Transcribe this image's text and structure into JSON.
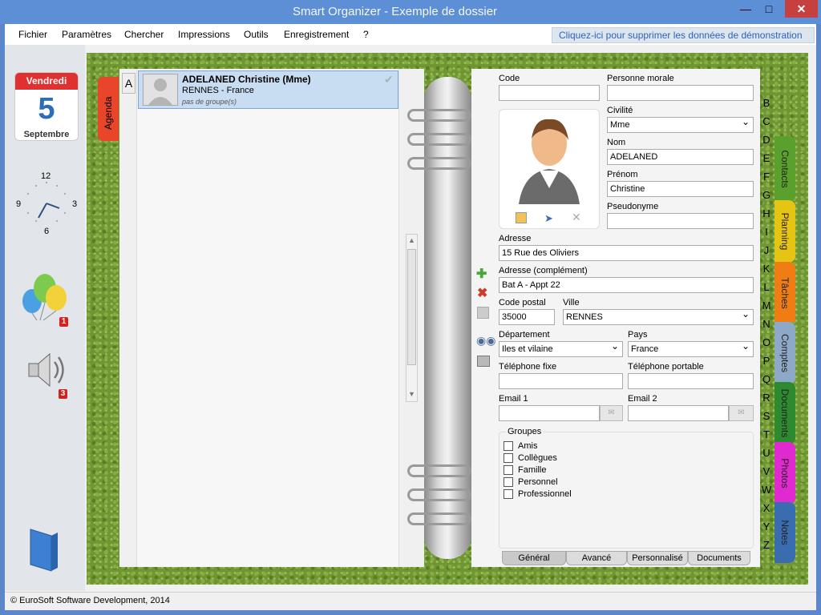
{
  "window": {
    "title": "Smart Organizer - Exemple de dossier",
    "minimize": "—",
    "maximize": "□",
    "close": "✕"
  },
  "menu": {
    "items": [
      "Fichier",
      "Paramètres",
      "Chercher",
      "Impressions",
      "Outils",
      "Enregistrement",
      "?"
    ],
    "demo_link": "Cliquez-ici pour supprimer les données de démonstration"
  },
  "calendar": {
    "weekday": "Vendredi",
    "day": "5",
    "month": "Septembre"
  },
  "clock": {
    "n12": "12",
    "n3": "3",
    "n6": "6",
    "n9": "9"
  },
  "badges": {
    "balloons": "1",
    "sound": "3"
  },
  "left_tab": {
    "label": "Agenda",
    "letter": "A"
  },
  "contact": {
    "name": "ADELANED Christine (Mme)",
    "location": "RENNES - France",
    "group": "pas de groupe(s)"
  },
  "form": {
    "code": {
      "label": "Code",
      "value": ""
    },
    "moral": {
      "label": "Personne morale",
      "value": ""
    },
    "civilite": {
      "label": "Civilité",
      "value": "Mme"
    },
    "nom": {
      "label": "Nom",
      "value": "ADELANED"
    },
    "prenom": {
      "label": "Prénom",
      "value": "Christine"
    },
    "pseudo": {
      "label": "Pseudonyme",
      "value": ""
    },
    "adresse": {
      "label": "Adresse",
      "value": "15 Rue des Oliviers"
    },
    "adresse2": {
      "label": "Adresse (complément)",
      "value": "Bat A - Appt 22"
    },
    "cp": {
      "label": "Code postal",
      "value": "35000"
    },
    "ville": {
      "label": "Ville",
      "value": "RENNES"
    },
    "dept": {
      "label": "Département",
      "value": "Iles et vilaine"
    },
    "pays": {
      "label": "Pays",
      "value": "France"
    },
    "tel": {
      "label": "Téléphone fixe",
      "value": ""
    },
    "mobile": {
      "label": "Téléphone portable",
      "value": ""
    },
    "email1": {
      "label": "Email 1",
      "value": ""
    },
    "email2": {
      "label": "Email 2",
      "value": ""
    }
  },
  "groups": {
    "legend": "Groupes",
    "items": [
      "Amis",
      "Collègues",
      "Famille",
      "Personnel",
      "Professionnel"
    ]
  },
  "bottom_tabs": [
    "Général",
    "Avancé",
    "Personnalisé",
    "Documents"
  ],
  "alphabet": [
    "B",
    "C",
    "D",
    "E",
    "F",
    "G",
    "H",
    "I",
    "J",
    "K",
    "L",
    "M",
    "N",
    "O",
    "P",
    "Q",
    "R",
    "S",
    "T",
    "U",
    "V",
    "W",
    "X",
    "Y",
    "Z"
  ],
  "side_tabs": [
    {
      "label": "Contacts",
      "color": "#5aa02c"
    },
    {
      "label": "Planning",
      "color": "#e6c414"
    },
    {
      "label": "Tâches",
      "color": "#f07c14"
    },
    {
      "label": "Comptes",
      "color": "#8ea8c8"
    },
    {
      "label": "Documents",
      "color": "#2e8a2e"
    },
    {
      "label": "Photos",
      "color": "#e02ad0"
    },
    {
      "label": "Notes",
      "color": "#3a6cb0"
    }
  ],
  "status": {
    "copyright": "© EuroSoft Software Development, 2014"
  }
}
